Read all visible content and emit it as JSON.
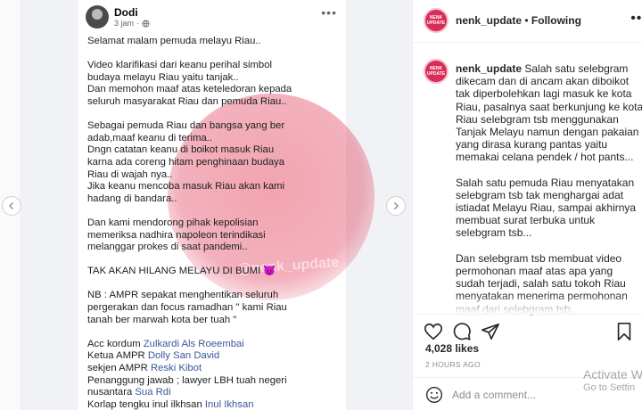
{
  "fb_post": {
    "author": "Dodi",
    "time": "3 jam",
    "lines": [
      "Selamat malam pemuda melayu Riau..",
      "",
      "Video klarifikasi dari keanu perihal simbol",
      "budaya melayu Riau yaitu tanjak..",
      "Dan memohon maaf atas keteledoran kepada",
      "seluruh masyarakat Riau dan pemuda Riau..",
      "",
      "Sebagai pemuda Riau dan bangsa yang ber",
      "adab,maaf keanu di terima..",
      "Dngn catatan keanu di boikot masuk Riau",
      "karna ada coreng hitam penghinaan budaya",
      "Riau di wajah nya..",
      "Jika keanu mencoba masuk Riau akan kami",
      "hadang di bandara..",
      "",
      "Dan kami mendorong pihak kepolisian",
      "memeriksa nadhira napoleon terindikasi",
      "melanggar prokes di saat pandemi..",
      "",
      "TAK AKAN HILANG MELAYU DI BUMI 😈",
      "",
      "NB : AMPR sepakat menghentikan seluruh",
      "pergerakan dan focus ramadhan \" kami Riau",
      "tanah ber marwah kota ber tuah \"",
      ""
    ],
    "credits": [
      {
        "label": "Acc kordum ",
        "link": "Zulkardi Als Roeembai"
      },
      {
        "label": "Ketua AMPR ",
        "link": "Dolly San David"
      },
      {
        "label": "sekjen AMPR ",
        "link": "Reski Kibot"
      },
      {
        "label": "Penanggung jawab ; lawyer LBH tuah negeri",
        "link": ""
      },
      {
        "label": "nusantara ",
        "link": "Sua Rdi"
      },
      {
        "label": "Korlap tengku inul ilkhsan ",
        "link": "Inul Ikhsan"
      }
    ],
    "watermark": "@nenk_update"
  },
  "ig": {
    "username": "nenk_update",
    "separator": "•",
    "follow_status": "Following",
    "avatar_text": "NENK UPDATE",
    "caption_lines": [
      "Salah satu selebgram",
      "dikecam dan di ancam akan diboikot",
      "tak diperbolehkan lagi masuk ke kota",
      "Riau, pasalnya saat berkunjung ke kota",
      "Riau selebgram tsb menggunakan",
      "Tanjak Melayu namun dengan pakaian",
      "yang dirasa kurang pantas yaitu",
      "memakai celana pendek / hot pants...",
      "",
      "Salah satu pemuda Riau menyatakan",
      "selebgram tsb tak menghargai adat",
      "istiadat Melayu Riau, sampai akhirnya",
      "membuat surat terbuka untuk",
      "selebgram tsb...",
      "",
      "Dan selebgram tsb membuat video",
      "permohonan maaf atas apa yang",
      "sudah terjadi, salah satu tokoh Riau",
      "menyatakan menerima permohonan",
      "maaf dari selebgram tsb..."
    ],
    "likes": "4,028 likes",
    "time_ago": "2 HOURS AGO",
    "comment_placeholder": "Add a comment..."
  },
  "os_watermark": {
    "title": "Activate W",
    "subtitle": "Go to Settin"
  },
  "colors": {
    "link": "#385898",
    "ig_text": "#262626",
    "muted": "#8e8e8e",
    "avatar_brand": "#d92c57"
  }
}
